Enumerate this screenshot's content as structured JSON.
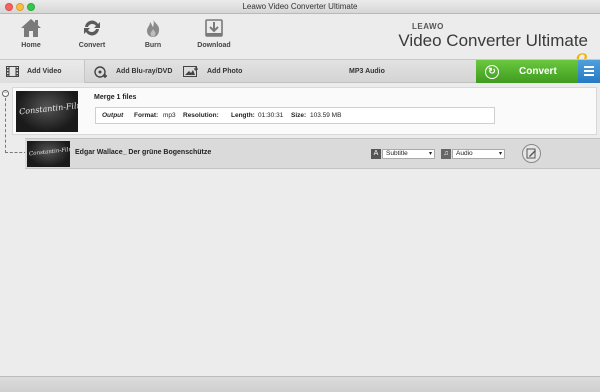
{
  "window": {
    "title": "Leawo Video Converter Ultimate"
  },
  "toolbar": {
    "home_label": "Home",
    "convert_label": "Convert",
    "burn_label": "Burn",
    "download_label": "Download"
  },
  "brand": {
    "logo_text": "LEAWO",
    "product": "Video Converter Ultimate",
    "version": "8",
    "accent_color": "#f2b100"
  },
  "subbar": {
    "add_video": "Add Video",
    "add_bluray": "Add Blu-ray/DVD",
    "add_photo": "Add Photo",
    "profile": "MP3 Audio",
    "convert": "Convert",
    "convert_color": "#4caf2a",
    "menu_color": "#2f87cf"
  },
  "merge": {
    "title": "Merge 1 files",
    "thumb_text": "Constantin-Film",
    "output_label": "Output",
    "format_label": "Format:",
    "format_value": "mp3",
    "resolution_label": "Resolution:",
    "resolution_value": "",
    "length_label": "Length:",
    "length_value": "01:30:31",
    "size_label": "Size:",
    "size_value": "103.59 MB"
  },
  "file": {
    "name": "Edgar Wallace_ Der grüne Bogenschütze",
    "thumb_text": "Constantin-Film",
    "subtitle_value": "Subtitle",
    "audio_value": "Audio"
  }
}
